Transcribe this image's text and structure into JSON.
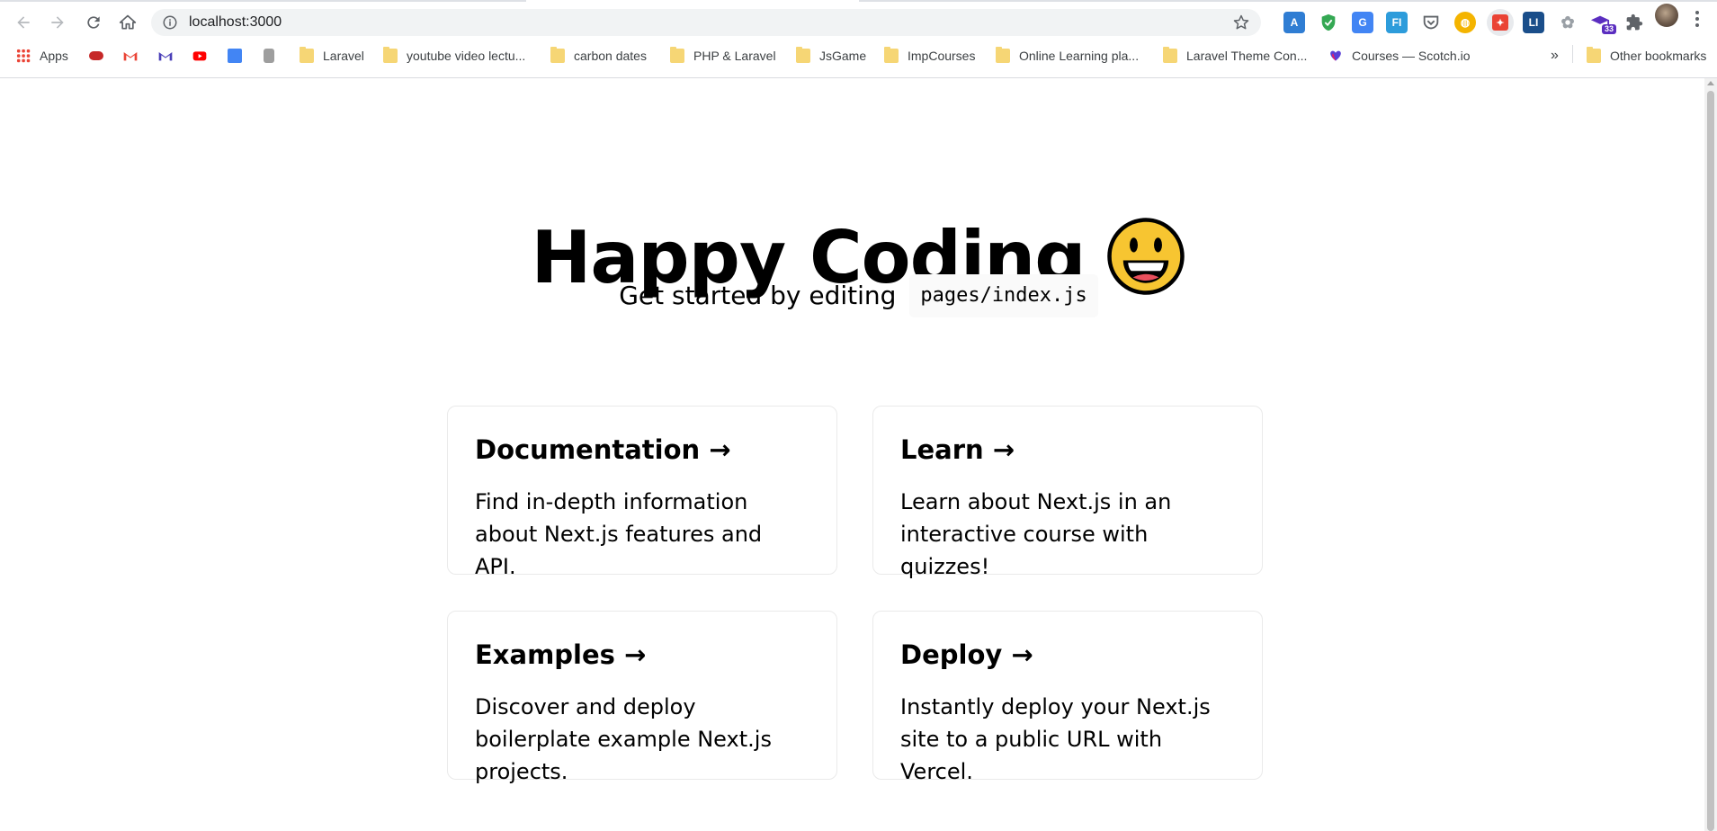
{
  "browser": {
    "url": "localhost:3000",
    "bookmarks": [
      {
        "label": "Apps",
        "icon": "apps-grid-icon"
      },
      {
        "label": "",
        "icon": "gamepad-icon"
      },
      {
        "label": "",
        "icon": "gmail-icon"
      },
      {
        "label": "",
        "icon": "gmail-icon"
      },
      {
        "label": "",
        "icon": "youtube-icon"
      },
      {
        "label": "",
        "icon": "google-translate-icon"
      },
      {
        "label": "",
        "icon": "robot-icon"
      },
      {
        "label": "Laravel",
        "icon": "folder-icon"
      },
      {
        "label": "youtube video lectu...",
        "icon": "folder-icon"
      },
      {
        "label": "carbon dates",
        "icon": "folder-icon"
      },
      {
        "label": "PHP & Laravel",
        "icon": "folder-icon"
      },
      {
        "label": "JsGame",
        "icon": "folder-icon"
      },
      {
        "label": "ImpCourses",
        "icon": "folder-icon"
      },
      {
        "label": "Online Learning pla...",
        "icon": "folder-icon"
      },
      {
        "label": "Laravel Theme Con...",
        "icon": "folder-icon"
      },
      {
        "label": "Courses — Scotch.io",
        "icon": "scotch-icon"
      }
    ],
    "overflow_label": "»",
    "other_bookmarks": "Other bookmarks",
    "extension_badge": "33"
  },
  "page": {
    "title": "Happy Coding",
    "title_emoji": "grinning-face-emoji",
    "description_prefix": "Get started by editing",
    "description_code": "pages/index.js",
    "cards": [
      {
        "title": "Documentation →",
        "body": "Find in-depth information about Next.js features and API."
      },
      {
        "title": "Learn →",
        "body": "Learn about Next.js in an interactive course with quizzes!"
      },
      {
        "title": "Examples →",
        "body": "Discover and deploy boilerplate example Next.js projects."
      },
      {
        "title": "Deploy →",
        "body": "Instantly deploy your Next.js site to a public URL with Vercel."
      }
    ]
  },
  "colors": {
    "card_border": "#eaeaea",
    "code_bg": "#fafafa",
    "folder": "#f6d675",
    "emoji": "#f7c531"
  }
}
